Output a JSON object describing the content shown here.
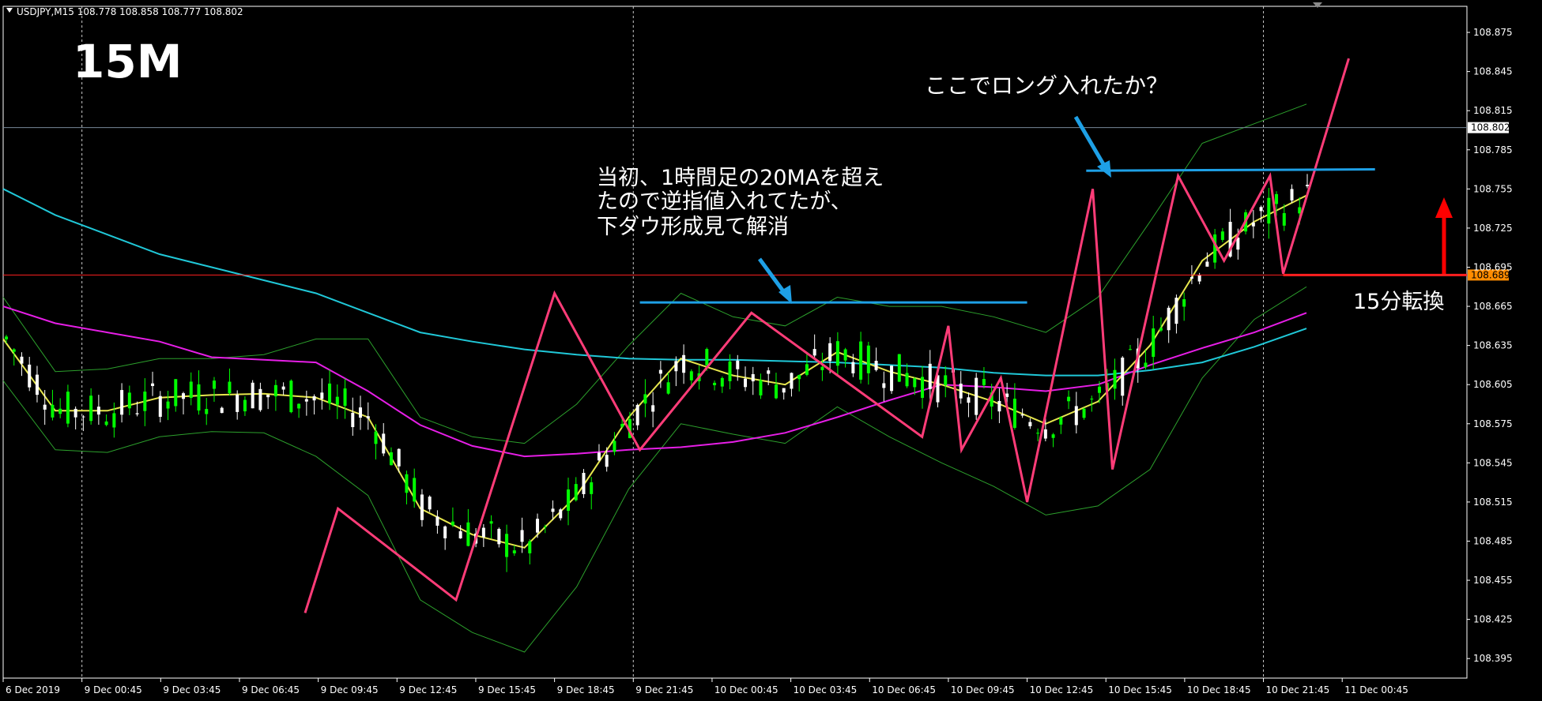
{
  "header": {
    "menu_arrow": "▼",
    "title": "USDJPY,M15 108.778 108.858 108.777 108.802"
  },
  "timeframe_label": "15M",
  "annotations": {
    "long_question": "ここでロング入れたか？",
    "note_line1": "当初、1時間足の20MAを超え",
    "note_line2": "たので逆指値入れてたが、",
    "note_line3": "下ダウ形成見て解消",
    "reversal": "15分転換"
  },
  "colors": {
    "background": "#000000",
    "grid": "#c8c8c8",
    "bull_candle": "#00ff00",
    "bear_candle": "#ffffff",
    "bollinger": "#2ca02c",
    "ma_fast": "#e6e64d",
    "ma_mid": "#e61ee6",
    "ma_slow": "#20c8d8",
    "zigzag": "#ff3c78",
    "trendline": "#1ea0e6",
    "level_line": "#ff2020",
    "arrow": "#ff0000",
    "price_badge": "#ff8c00"
  },
  "chart_data": {
    "type": "candlestick",
    "symbol": "USDJPY",
    "timeframe": "M15",
    "ohlc_current": {
      "open": 108.778,
      "high": 108.858,
      "low": 108.777,
      "close": 108.802
    },
    "current_price_label": "108.802",
    "level_price_label": "108.689",
    "level_price": 108.689,
    "ylim": [
      108.38,
      108.895
    ],
    "y_ticks": [
      "108.875",
      "108.845",
      "108.815",
      "108.785",
      "108.755",
      "108.725",
      "108.695",
      "108.665",
      "108.635",
      "108.605",
      "108.575",
      "108.545",
      "108.515",
      "108.485",
      "108.455",
      "108.425",
      "108.395"
    ],
    "x_ticks": [
      "6 Dec 2019",
      "9 Dec 00:45",
      "9 Dec 03:45",
      "9 Dec 06:45",
      "9 Dec 09:45",
      "9 Dec 12:45",
      "9 Dec 15:45",
      "9 Dec 18:45",
      "9 Dec 21:45",
      "10 Dec 00:45",
      "10 Dec 03:45",
      "10 Dec 06:45",
      "10 Dec 09:45",
      "10 Dec 12:45",
      "10 Dec 15:45",
      "10 Dec 18:45",
      "10 Dec 21:45",
      "11 Dec 00:45"
    ],
    "vertical_separators_at": [
      "9 Dec 00:45",
      "9 Dec 21:45",
      "10 Dec 21:45"
    ],
    "zigzag": [
      {
        "t": "9 Dec 09:15",
        "price": 108.43
      },
      {
        "t": "9 Dec 10:30",
        "price": 108.51
      },
      {
        "t": "9 Dec 15:00",
        "price": 108.44
      },
      {
        "t": "9 Dec 18:45",
        "price": 108.675
      },
      {
        "t": "9 Dec 22:00",
        "price": 108.555
      },
      {
        "t": "10 Dec 02:15",
        "price": 108.66
      },
      {
        "t": "10 Dec 08:45",
        "price": 108.565
      },
      {
        "t": "10 Dec 09:45",
        "price": 108.65
      },
      {
        "t": "10 Dec 10:15",
        "price": 108.555
      },
      {
        "t": "10 Dec 11:45",
        "price": 108.61
      },
      {
        "t": "10 Dec 12:45",
        "price": 108.515
      },
      {
        "t": "10 Dec 15:15",
        "price": 108.755
      },
      {
        "t": "10 Dec 16:00",
        "price": 108.54
      },
      {
        "t": "10 Dec 18:30",
        "price": 108.765
      },
      {
        "t": "10 Dec 20:15",
        "price": 108.7
      },
      {
        "t": "10 Dec 22:00",
        "price": 108.765
      },
      {
        "t": "10 Dec 22:30",
        "price": 108.69
      },
      {
        "t": "11 Dec 01:00",
        "price": 108.855
      }
    ],
    "trendlines": [
      {
        "from": {
          "t": "9 Dec 22:00",
          "price": 108.668
        },
        "to": {
          "t": "10 Dec 12:45",
          "price": 108.668
        }
      },
      {
        "from": {
          "t": "10 Dec 15:00",
          "price": 108.769
        },
        "to": {
          "t": "11 Dec 02:00",
          "price": 108.77
        }
      }
    ],
    "series": [
      {
        "name": "",
        "values": [
          108.755,
          108.735,
          108.72,
          108.705,
          108.695,
          108.685,
          108.675,
          108.66,
          108.645,
          108.638,
          108.632,
          108.628,
          108.625,
          108.624,
          108.624,
          108.623,
          108.622,
          108.62,
          108.618,
          108.614,
          108.612,
          108.612,
          108.616,
          108.622,
          108.634,
          108.648
        ]
      },
      {
        "name": "",
        "values": [
          108.665,
          108.652,
          108.645,
          108.638,
          108.626,
          108.624,
          108.622,
          108.6,
          108.574,
          108.558,
          108.55,
          108.552,
          108.555,
          108.557,
          108.561,
          108.568,
          108.58,
          108.593,
          108.605,
          108.603,
          108.6,
          108.605,
          108.62,
          108.633,
          108.645,
          108.66
        ]
      },
      {
        "name": "",
        "values": [
          108.64,
          108.585,
          108.585,
          108.595,
          108.597,
          108.598,
          108.595,
          108.58,
          108.51,
          108.49,
          108.48,
          108.52,
          108.58,
          108.625,
          108.612,
          108.605,
          108.63,
          108.615,
          108.605,
          108.592,
          108.575,
          108.592,
          108.635,
          108.7,
          108.73,
          108.75
        ]
      }
    ]
  }
}
